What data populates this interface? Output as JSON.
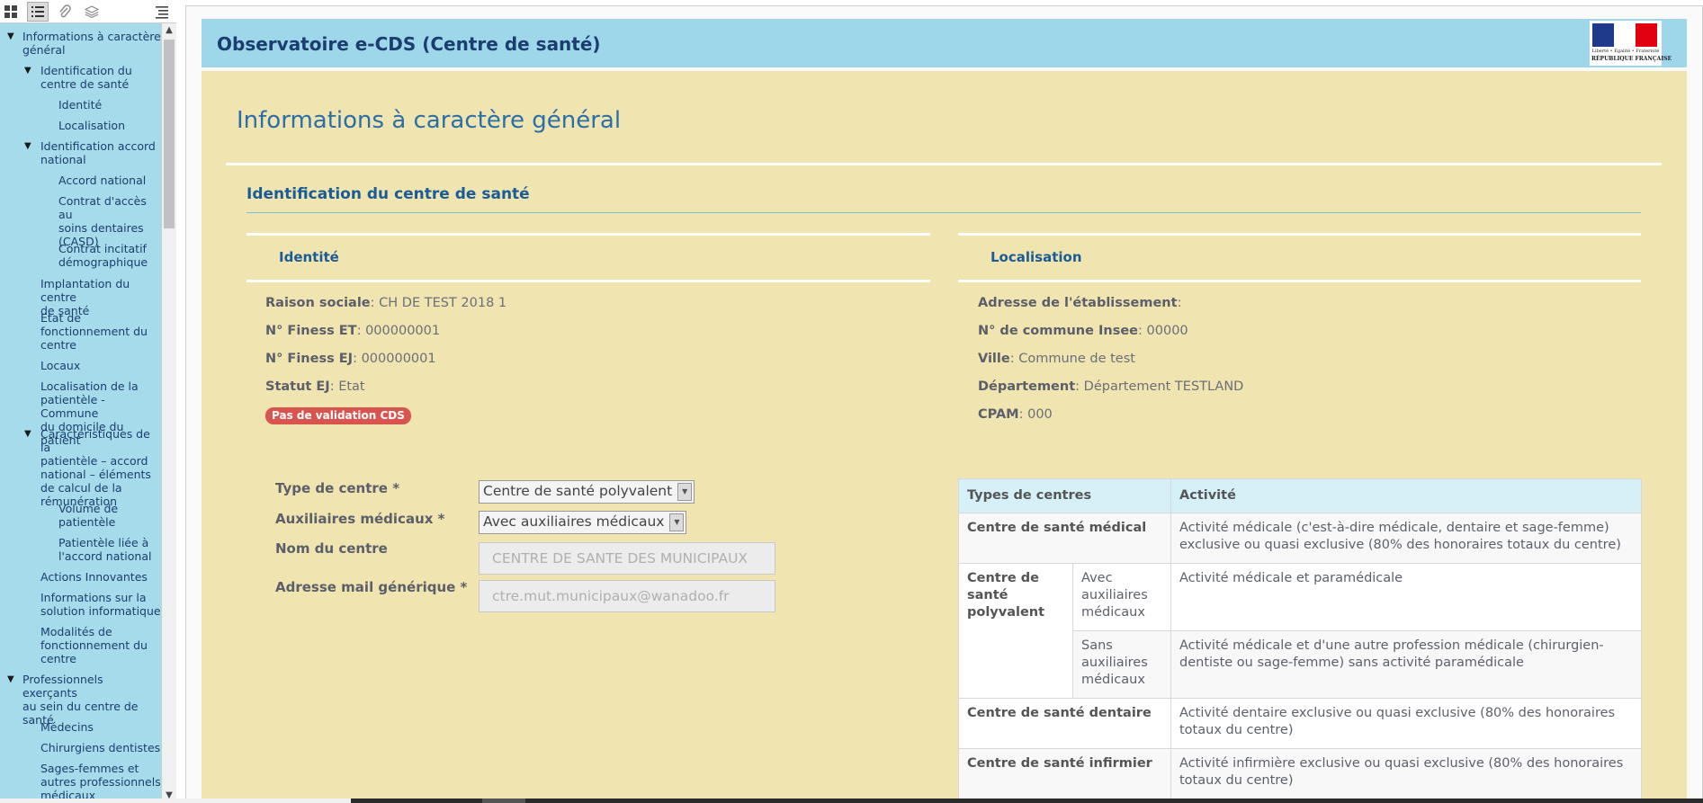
{
  "sidebar": {
    "toolbar": {
      "thumbnails_icon": "grid-icon",
      "outline_icon": "list-icon",
      "attachments_icon": "paperclip-icon",
      "layers_icon": "layers-icon",
      "options_icon": "menu-icon"
    },
    "items": [
      {
        "label_lines": [
          "Informations à caractère",
          "général"
        ],
        "arrow": "▼"
      },
      {
        "label_lines": [
          "Identification du",
          "centre de santé"
        ],
        "arrow": "▼"
      },
      {
        "label_lines": [
          "Identité"
        ]
      },
      {
        "label_lines": [
          "Localisation"
        ]
      },
      {
        "label_lines": [
          "Identification accord",
          "national"
        ],
        "arrow": "▼"
      },
      {
        "label_lines": [
          "Accord national"
        ]
      },
      {
        "label_lines": [
          "Contrat d'accès au",
          "soins dentaires",
          "(CASD)"
        ]
      },
      {
        "label_lines": [
          "Contrat incitatif",
          "démographique"
        ]
      },
      {
        "label_lines": [
          "Implantation du centre",
          "de santé"
        ]
      },
      {
        "label_lines": [
          "Etat de",
          "fonctionnement du",
          "centre"
        ]
      },
      {
        "label_lines": [
          "Locaux"
        ]
      },
      {
        "label_lines": [
          "Localisation de la",
          "patientèle - Commune",
          "du domicile du patient"
        ]
      },
      {
        "label_lines": [
          "Caractéristiques de la",
          "patientèle – accord",
          "national – éléments",
          "de calcul de la",
          "rémunération"
        ],
        "arrow": "▼"
      },
      {
        "label_lines": [
          "Volume de",
          "patientèle"
        ]
      },
      {
        "label_lines": [
          "Patientèle liée à",
          "l'accord national"
        ]
      },
      {
        "label_lines": [
          "Actions Innovantes"
        ]
      },
      {
        "label_lines": [
          "Informations sur la",
          "solution informatique"
        ]
      },
      {
        "label_lines": [
          "Modalités de",
          "fonctionnement du",
          "centre"
        ]
      },
      {
        "label_lines": [
          "Professionnels exerçants",
          "au sein du centre de",
          "santé"
        ],
        "arrow": "▼"
      },
      {
        "label_lines": [
          "Médecins"
        ]
      },
      {
        "label_lines": [
          "Chirurgiens dentistes"
        ]
      },
      {
        "label_lines": [
          "Sages-femmes et",
          "autres professionnels",
          "médicaux"
        ]
      }
    ]
  },
  "header": {
    "title": "Observatoire e-CDS (Centre de santé)",
    "logo_motto": "Liberté • Égalité • Fraternité",
    "logo_republic": "RÉPUBLIQUE FRANÇAISE"
  },
  "page": {
    "title": "Informations à caractère général",
    "section_title": "Identification du centre de santé"
  },
  "identite": {
    "title": "Identité",
    "fields": [
      {
        "label": "Raison sociale",
        "value": "CH DE TEST 2018 1"
      },
      {
        "label": "N° Finess ET",
        "value": "000000001"
      },
      {
        "label": "N° Finess EJ",
        "value": "000000001"
      },
      {
        "label": "Statut EJ",
        "value": "Etat"
      }
    ],
    "badge": "Pas de validation CDS"
  },
  "localisation": {
    "title": "Localisation",
    "fields": [
      {
        "label": "Adresse de l'établissement",
        "value": ""
      },
      {
        "label": "N° de commune Insee",
        "value": "00000"
      },
      {
        "label": "Ville",
        "value": "Commune de test"
      },
      {
        "label": "Département",
        "value": "Département TESTLAND"
      },
      {
        "label": "CPAM",
        "value": "000"
      }
    ]
  },
  "form": {
    "type_centre": {
      "label": "Type de centre *",
      "value": "Centre de santé polyvalent"
    },
    "auxiliaires": {
      "label": "Auxiliaires médicaux *",
      "value": "Avec auxiliaires médicaux"
    },
    "nom_centre": {
      "label": "Nom du centre",
      "value": "CENTRE DE SANTE DES MUNICIPAUX"
    },
    "mail": {
      "label": "Adresse mail générique *",
      "value": "ctre.mut.municipaux@wanadoo.fr"
    }
  },
  "table": {
    "headers": [
      "Types de centres",
      "Activité"
    ],
    "rows": {
      "medical": {
        "type": "Centre de santé médical",
        "activity": "Activité médicale (c'est-à-dire médicale, dentaire et sage-femme) exclusive ou quasi exclusive (80% des honoraires totaux du centre)"
      },
      "polyvalent": {
        "type": "Centre de santé polyvalent",
        "avec": {
          "sub": "Avec auxiliaires médicaux",
          "activity": "Activité médicale et paramédicale"
        },
        "sans": {
          "sub": "Sans auxiliaires médicaux",
          "activity": "Activité médicale et d'une autre profession médicale (chirurgien-dentiste ou sage-femme) sans activité paramédicale"
        }
      },
      "dentaire": {
        "type": "Centre de santé dentaire",
        "activity": "Activité dentaire exclusive ou quasi exclusive (80% des honoraires totaux du centre)"
      },
      "infirmier": {
        "type": "Centre de santé infirmier",
        "activity": "Activité infirmière exclusive ou quasi exclusive (80% des honoraires totaux du centre)"
      }
    }
  },
  "colors": {
    "sidebar_bg": "#a5dbea",
    "header_bg": "#9ed6ea",
    "content_bg": "#f0e4b0",
    "accent": "#1b5c96",
    "badge": "#d9534f"
  }
}
